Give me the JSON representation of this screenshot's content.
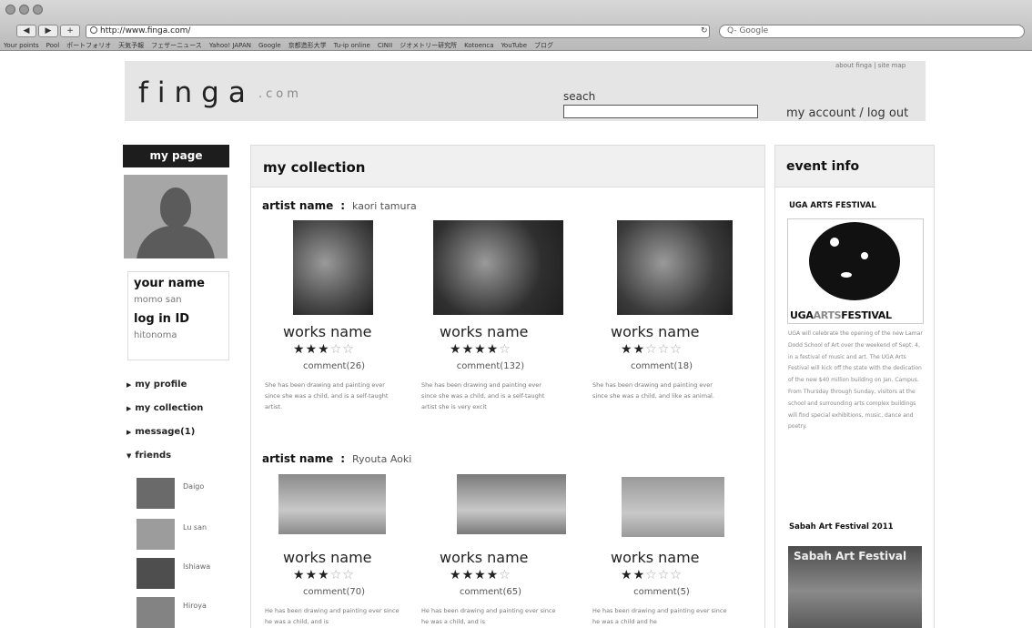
{
  "browser": {
    "url": "http://www.finga.com/",
    "search_placeholder": "Q- Google",
    "back_label": "◀",
    "forward_label": "▶",
    "plus_label": "+",
    "bookmarks": [
      "Your points",
      "Pool",
      "ポートフォリオ",
      "天気予報",
      "フェザーニュース",
      "Yahoo! JAPAN",
      "Google",
      "京都造形大学",
      "Tu-ip online",
      "CINII",
      "ジオメトリー研究所",
      "Kotoenca",
      "YouTube",
      "ブログ"
    ]
  },
  "header": {
    "logo_main": "finga",
    "logo_suffix": ".com",
    "search_label": "seach",
    "account_links": "my account / log out",
    "about_line": "about finga | site map"
  },
  "sidebar": {
    "my_page": "my page",
    "name_heading": "your name",
    "name_value": "momo san",
    "login_heading": "log in ID",
    "login_value": "hitonoma",
    "nav": [
      "my profile",
      "my collection",
      "message(1)",
      "friends"
    ],
    "friends": [
      "Daigo",
      "Lu san",
      "Ishiawa",
      "Hiroya"
    ]
  },
  "collection": {
    "title": "my collection",
    "artist_label": "artist name",
    "colon": ":",
    "works_label": "works name",
    "artists": [
      {
        "name": "kaori tamura",
        "works": [
          {
            "rating": 3,
            "max": 5,
            "comment": "comment(26)",
            "desc": "She has been drawing and painting ever since she was a child, and is a self-taught artist."
          },
          {
            "rating": 4,
            "max": 5,
            "comment": "comment(132)",
            "desc": "She has been drawing and painting ever since she was a child, and is a self-taught artist she is very excit"
          },
          {
            "rating": 2,
            "max": 5,
            "comment": "comment(18)",
            "desc": "She has been drawing and painting ever since she was a child, and like as animal."
          }
        ]
      },
      {
        "name": "Ryouta Aoki",
        "works": [
          {
            "rating": 3,
            "max": 5,
            "comment": "comment(70)",
            "desc": "He has been drawing and painting ever since he was a child, and is"
          },
          {
            "rating": 4,
            "max": 5,
            "comment": "comment(65)",
            "desc": "He has been drawing and painting ever since he was a child, and is"
          },
          {
            "rating": 2,
            "max": 5,
            "comment": "comment(5)",
            "desc": "He has been drawing and painting ever since he was a child and he"
          }
        ]
      }
    ]
  },
  "events": {
    "title": "event info",
    "event1_title": "UGA ARTS FESTIVAL",
    "event1_logo_a": "UGA",
    "event1_logo_b": "ARTS",
    "event1_logo_c": "FESTIVAL",
    "event1_text": "UGA will celebrate the opening of the new Lamar Dodd School of Art over the weekend of Sept. 4, in a festival of music and art. The UGA Arts Festival will kick off the state with the dedication of the new $40 million building on Jan. Campus. From Thursday through Sunday, visitors at the school and surrounding arts complex buildings will find special exhibitions, music, dance and poetry.",
    "event2_title": "Sabah Art Festival 2011",
    "event2_image_text": "Sabah Art Festival"
  }
}
